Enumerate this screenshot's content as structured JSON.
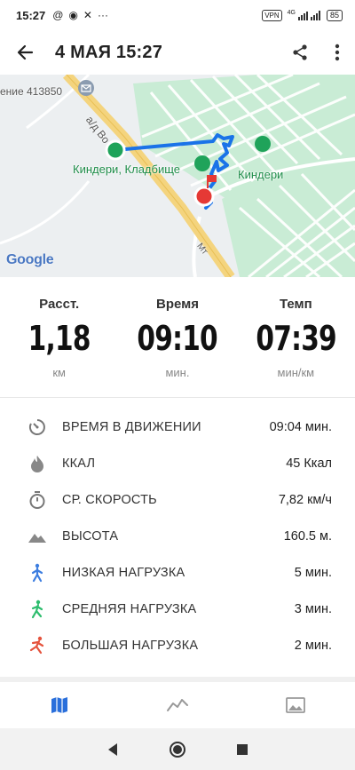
{
  "status_bar": {
    "time": "15:27",
    "notification_icons": [
      "@",
      "◉",
      "✕",
      "···"
    ],
    "vpn": "VPN",
    "network": "4G",
    "battery": "85"
  },
  "header": {
    "title": "4 МАЯ 15:27",
    "back_icon": "arrow-back-icon",
    "share_icon": "share-icon",
    "more_icon": "more-vert-icon"
  },
  "map": {
    "labels": {
      "post_office": "ение 413850",
      "road": "а/д Во",
      "cemetery": "Киндери, Кладбище",
      "park": "Киндери",
      "road2": "Мт"
    },
    "logo": "Google",
    "colors": {
      "track": "#1a73e8",
      "start": "#1fa35a",
      "finish": "#e53935",
      "park": "#c9ecd5",
      "road": "#f4d47e"
    }
  },
  "stats": [
    {
      "label": "Расст.",
      "value": "1,18",
      "unit": "км"
    },
    {
      "label": "Время",
      "value": "09:10",
      "unit": "мин."
    },
    {
      "label": "Темп",
      "value": "07:39",
      "unit": "мин/км"
    }
  ],
  "details": [
    {
      "icon": "moving-time-icon",
      "label": "ВРЕМЯ В ДВИЖЕНИИ",
      "value": "09:04 мин."
    },
    {
      "icon": "flame-icon",
      "label": "ККАЛ",
      "value": "45 Ккал"
    },
    {
      "icon": "stopwatch-icon",
      "label": "СР. СКОРОСТЬ",
      "value": "7,82 км/ч"
    },
    {
      "icon": "mountain-icon",
      "label": "ВЫСОТА",
      "value": "160.5 м."
    },
    {
      "icon": "walker-low-icon",
      "label": "НИЗКАЯ НАГРУЗКА",
      "value": "5 мин."
    },
    {
      "icon": "walker-medium-icon",
      "label": "СРЕДНЯЯ НАГРУЗКА",
      "value": "3 мин."
    },
    {
      "icon": "runner-high-icon",
      "label": "БОЛЬШАЯ НАГРУЗКА",
      "value": "2 мин."
    }
  ],
  "tabs": [
    {
      "icon": "map-icon",
      "active": true
    },
    {
      "icon": "chart-line-icon",
      "active": false
    },
    {
      "icon": "image-icon",
      "active": false
    }
  ]
}
